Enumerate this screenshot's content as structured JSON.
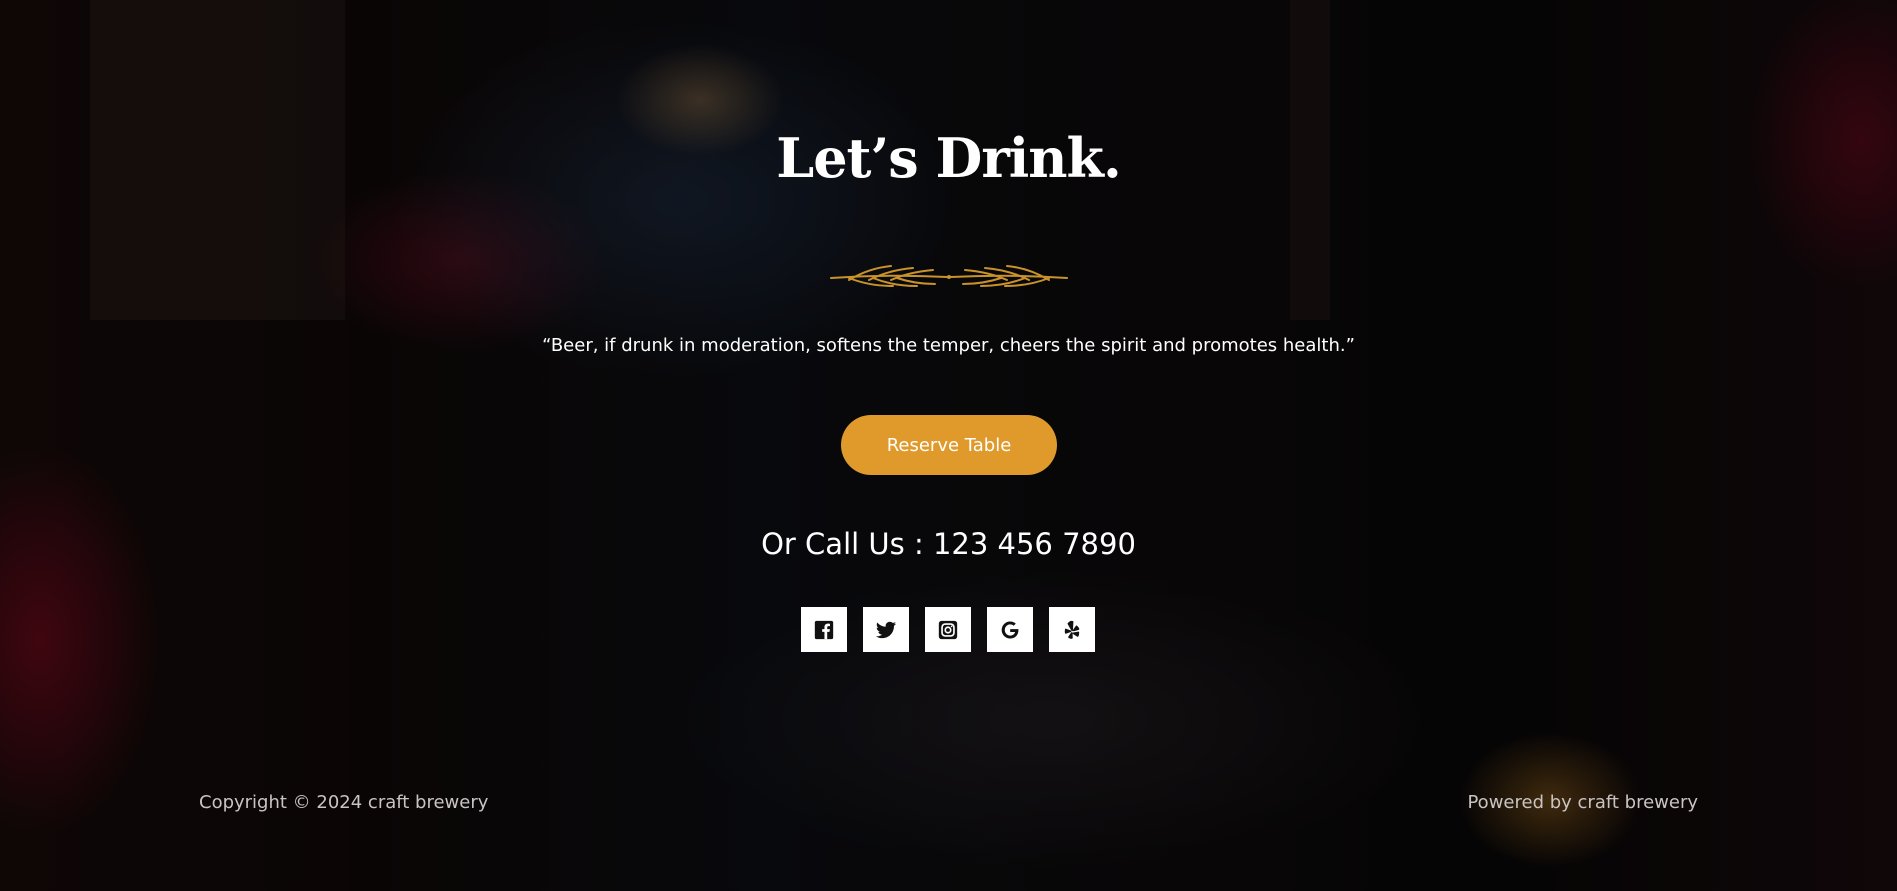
{
  "hero": {
    "title": "Let’s Drink.",
    "quote": "“Beer, if drunk in moderation, softens the temper, cheers the spirit and promotes health.”",
    "reserve_label": "Reserve Table",
    "call_text": "Or Call Us : 123 456 7890"
  },
  "social": [
    {
      "name": "facebook",
      "icon": "facebook-icon"
    },
    {
      "name": "twitter",
      "icon": "twitter-icon"
    },
    {
      "name": "instagram",
      "icon": "instagram-icon"
    },
    {
      "name": "google",
      "icon": "google-icon"
    },
    {
      "name": "yelp",
      "icon": "yelp-icon"
    }
  ],
  "footer": {
    "copyright": "Copyright © 2024 craft brewery",
    "powered": "Powered by craft brewery"
  },
  "colors": {
    "accent": "#df9a2b",
    "text": "#ffffff",
    "footer_text": "#c9c4c2"
  }
}
